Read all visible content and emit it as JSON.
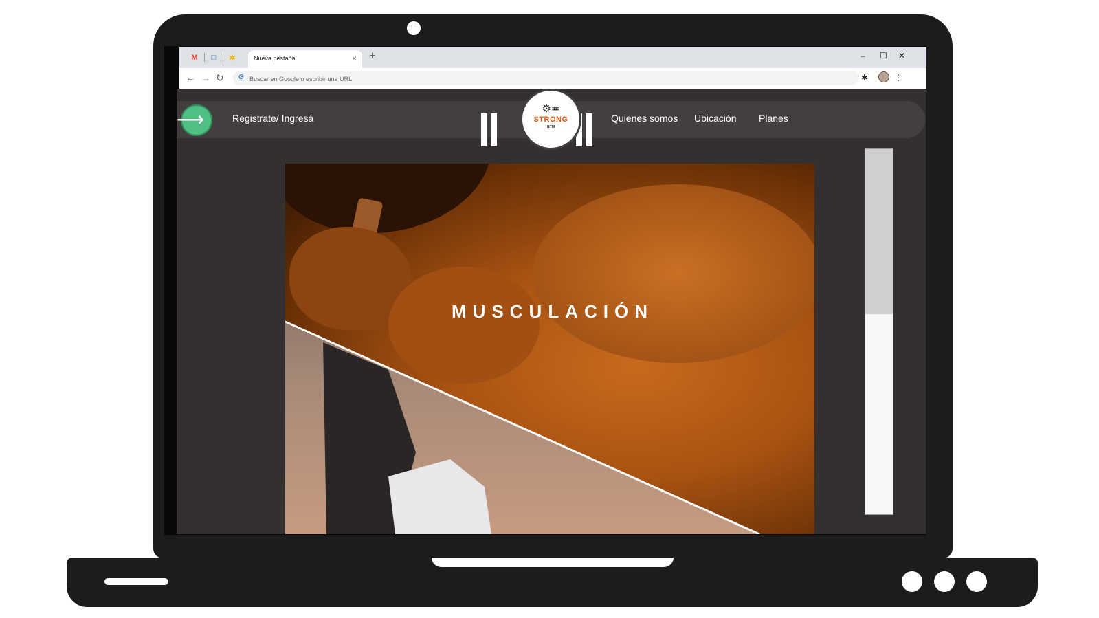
{
  "browser": {
    "pinned_tabs": [
      {
        "icon": "gmail-icon",
        "glyph": "M",
        "color": "#ea4335"
      },
      {
        "icon": "meet-icon",
        "glyph": "□",
        "color": "#1a73e8"
      },
      {
        "icon": "photos-icon",
        "glyph": "✲",
        "color": "#f4b400"
      }
    ],
    "active_tab": {
      "title": "Nueva pestaña",
      "close": "×"
    },
    "new_tab": "+",
    "window_controls": {
      "minimize": "–",
      "maximize": "☐",
      "close": "✕"
    },
    "nav": {
      "back": "←",
      "forward": "→",
      "reload": "↻"
    },
    "omnibox": {
      "icon": "G",
      "value": "",
      "placeholder": "Buscar en Google o escribir una URL"
    },
    "toolbar_icons": {
      "extensions": "✱",
      "menu": "⋮"
    }
  },
  "site": {
    "login_label": "Registrate/ Ingresá",
    "login_arrow": "⟶",
    "logo": {
      "icon": "⚙≖",
      "name": "STRONG",
      "sub": "GYM"
    },
    "nav_links": [
      "Quienes somos",
      "Ubicación",
      "Planes"
    ],
    "hero_title": "MUSCULACIÓN"
  },
  "colors": {
    "page_bg": "#353030",
    "navbar_bg": "#443f3f",
    "login_accent": "#4fbf84",
    "brand_orange": "#e25f12",
    "hero_orange": "#c86a1c"
  }
}
